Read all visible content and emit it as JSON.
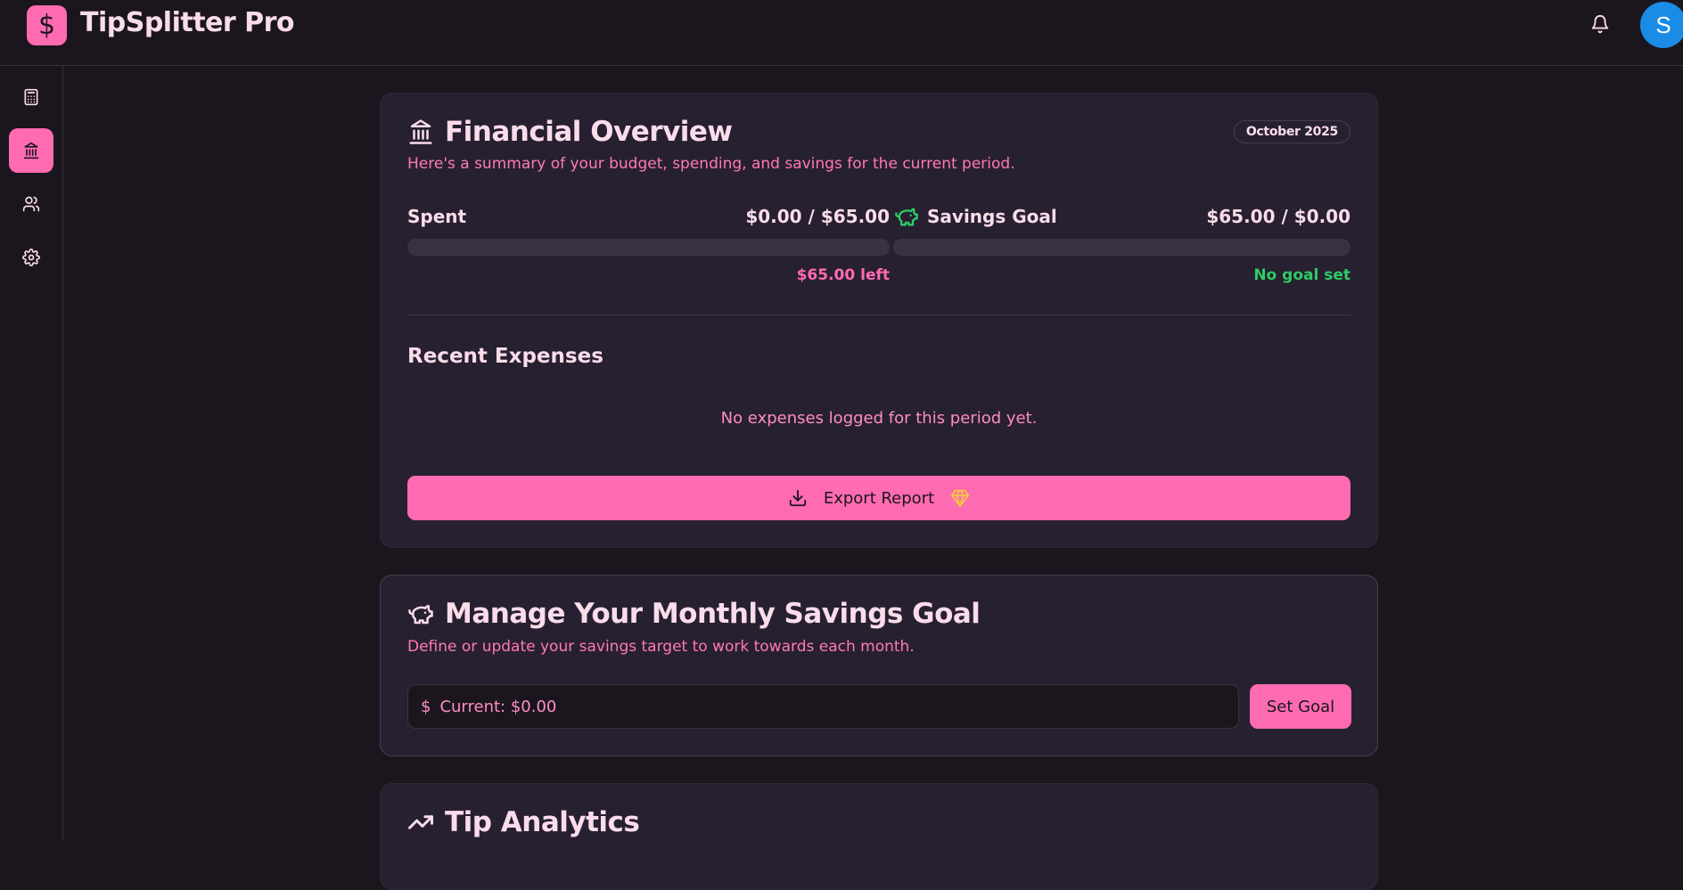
{
  "header": {
    "logo_symbol": "$",
    "app_title": "TipSplitter Pro",
    "notifications_icon": "bell-icon",
    "avatar_initial": "S"
  },
  "sidebar": {
    "items": [
      {
        "name": "calculator",
        "icon": "calculator-icon",
        "active": false
      },
      {
        "name": "finance",
        "icon": "bank-icon",
        "active": true
      },
      {
        "name": "people",
        "icon": "users-icon",
        "active": false
      },
      {
        "name": "settings",
        "icon": "gear-icon",
        "active": false
      }
    ]
  },
  "overview": {
    "title": "Financial Overview",
    "subtitle": "Here's a summary of your budget, spending, and savings for the current period.",
    "period_badge": "October 2025",
    "spent": {
      "label": "Spent",
      "value": "$0.00 / $65.00",
      "progress": 0,
      "note": "$65.00 left"
    },
    "savings": {
      "label": "Savings Goal",
      "value": "$65.00 / $0.00",
      "progress": 0,
      "note": "No goal set"
    },
    "recent_expenses_title": "Recent Expenses",
    "empty_message": "No expenses logged for this period yet.",
    "export_label": "Export Report"
  },
  "savings_goal": {
    "title": "Manage Your Monthly Savings Goal",
    "subtitle": "Define or update your savings target to work towards each month.",
    "currency_symbol": "$",
    "input_placeholder": "Current: $0.00",
    "set_goal_label": "Set Goal"
  },
  "analytics": {
    "title": "Tip Analytics"
  },
  "colors": {
    "accent": "#ff6bb1",
    "background": "#1b161e",
    "card": "#272030",
    "success": "#2ecb66",
    "premium": "#f5c542",
    "avatar": "#1a8ce6"
  }
}
